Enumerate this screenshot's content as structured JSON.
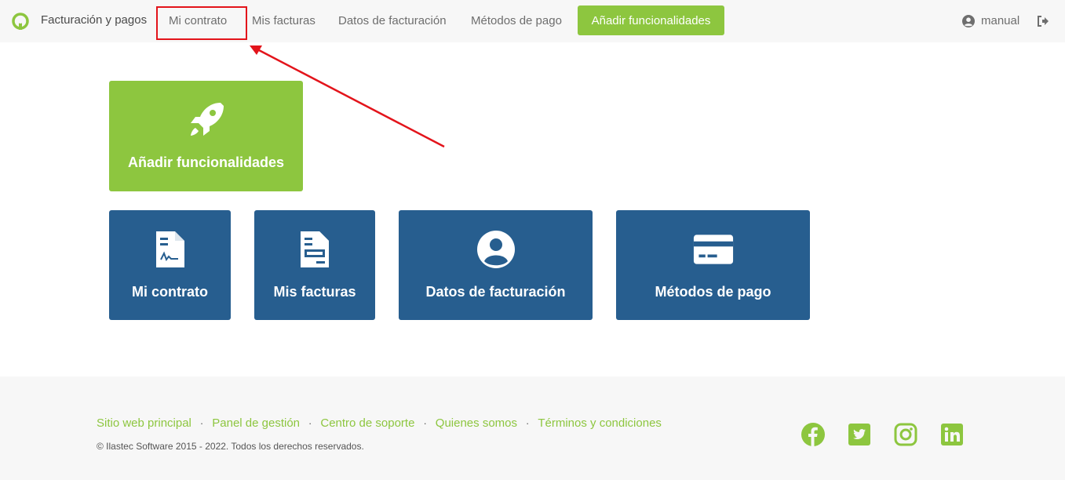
{
  "nav": {
    "brand": "Facturación y pagos",
    "links": [
      "Mi contrato",
      "Mis facturas",
      "Datos de facturación",
      "Métodos de pago"
    ],
    "cta": "Añadir funcionalidades",
    "user": "manual"
  },
  "tiles": {
    "add_features": "Añadir funcionalidades",
    "contract": "Mi contrato",
    "invoices": "Mis facturas",
    "billing_data": "Datos de facturación",
    "payment_methods": "Métodos de pago"
  },
  "footer": {
    "links": [
      "Sitio web principal",
      "Panel de gestión",
      "Centro de soporte",
      "Quienes somos",
      "Términos y condiciones"
    ],
    "separator": "·",
    "copyright": "© Ilastec Software 2015 - 2022. Todos los derechos reservados."
  },
  "colors": {
    "accent_green": "#8dc63f",
    "tile_blue": "#275e8f",
    "annotation_red": "#e3141b"
  },
  "icons": [
    "logo-icon",
    "user-circle-icon",
    "logout-icon",
    "rocket-icon",
    "contract-icon",
    "invoice-icon",
    "user-icon",
    "credit-card-icon",
    "facebook-icon",
    "twitter-icon",
    "instagram-icon",
    "linkedin-icon"
  ]
}
